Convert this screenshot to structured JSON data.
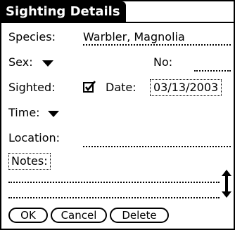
{
  "form": {
    "title": "Sighting Details",
    "species": {
      "label": "Species:",
      "value": "Warbler, Magnolia"
    },
    "sex": {
      "label": "Sex:",
      "value": ""
    },
    "number": {
      "label": "No:",
      "value": ""
    },
    "sighted": {
      "label": "Sighted:",
      "checked": true
    },
    "date": {
      "label": "Date:",
      "value": "03/13/2003"
    },
    "time": {
      "label": "Time:",
      "value": ""
    },
    "location": {
      "label": "Location:",
      "value": ""
    },
    "notes": {
      "label": "Notes:",
      "lines": [
        "",
        ""
      ]
    }
  },
  "buttons": {
    "ok": "OK",
    "cancel": "Cancel",
    "delete": "Delete"
  },
  "icons": {
    "dropdown": "triangle-down-icon",
    "check": "checkmark-icon",
    "scroll": "scroll-arrows-icon"
  }
}
